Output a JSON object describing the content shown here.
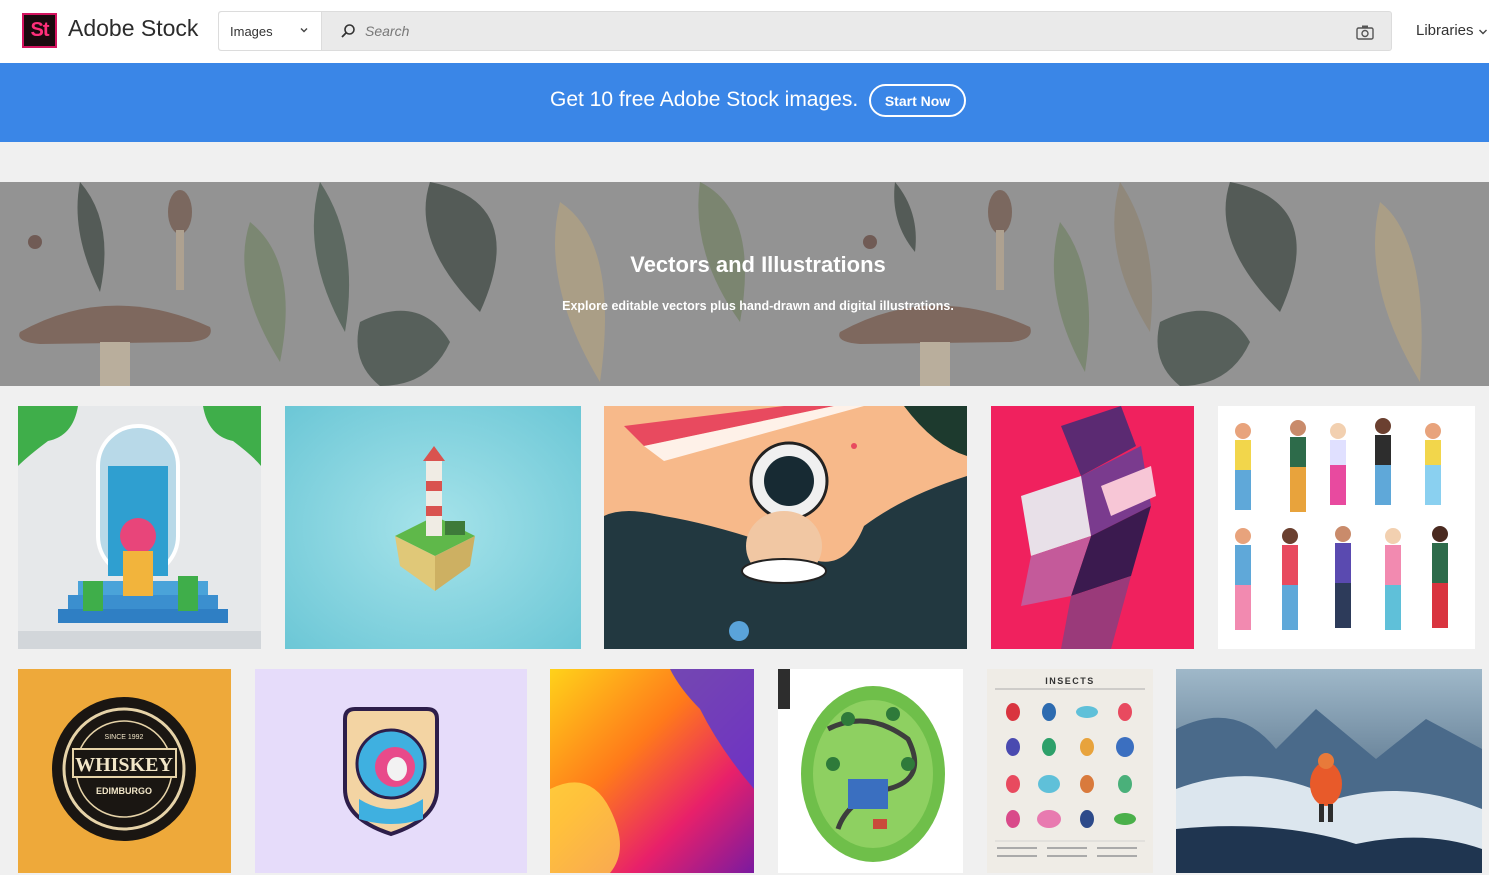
{
  "header": {
    "logo_text": "St",
    "brand": "Adobe Stock",
    "search": {
      "type_selected": "Images",
      "placeholder": "Search"
    },
    "libraries_label": "Libraries"
  },
  "promo": {
    "text": "Get 10 free Adobe Stock images.",
    "button_label": "Start Now",
    "color": "#3a86e7"
  },
  "hero": {
    "title": "Vectors and Illustrations",
    "subtitle": "Explore editable vectors plus hand-drawn and digital illustrations."
  },
  "gallery": {
    "badge_text": "WHISKEY",
    "badge_sub": "EDIMBURGO",
    "badge_year": "SINCE 1992",
    "insects_title": "INSECTS"
  },
  "icons": [
    "chevron-down-icon",
    "search-icon",
    "camera-icon"
  ]
}
